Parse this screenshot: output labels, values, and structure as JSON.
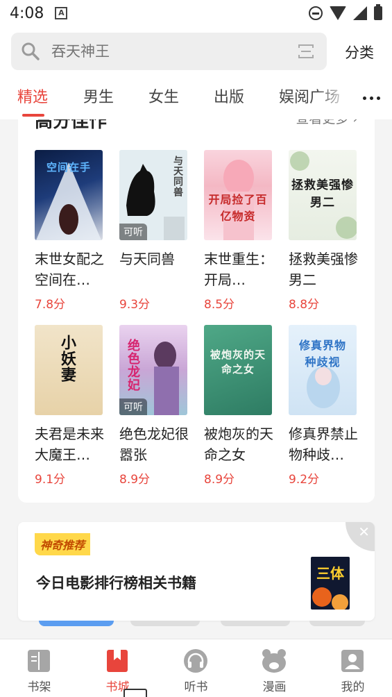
{
  "status_bar": {
    "time": "4:08",
    "notif_letter": "A"
  },
  "search": {
    "placeholder": "吞天神王"
  },
  "header": {
    "category_label": "分类"
  },
  "tabs": [
    {
      "label": "精选",
      "active": true
    },
    {
      "label": "男生",
      "active": false
    },
    {
      "label": "女生",
      "active": false
    },
    {
      "label": "出版",
      "active": false
    },
    {
      "label": "娱阅广场",
      "active": false
    }
  ],
  "section": {
    "title": "高分佳作",
    "more_label": "查看更多 ›"
  },
  "books": [
    {
      "title": "末世女配之空间在…",
      "score": "7.8分",
      "cover_text": "空间在手",
      "listen": ""
    },
    {
      "title": "与天同兽",
      "score": "9.3分",
      "cover_text": "与天同兽",
      "listen": "可听"
    },
    {
      "title": "末世重生：开局…",
      "score": "8.5分",
      "cover_text": "开局捡了百亿物资",
      "listen": ""
    },
    {
      "title": "拯救美强惨男二",
      "score": "8.8分",
      "cover_text": "拯救美强惨男二",
      "listen": ""
    },
    {
      "title": "夫君是未来大魔王…",
      "score": "9.1分",
      "cover_text": "小妖妻",
      "listen": ""
    },
    {
      "title": "绝色龙妃很嚣张",
      "score": "8.9分",
      "cover_text": "绝色龙妃",
      "listen": "可听"
    },
    {
      "title": "被炮灰的天命之女",
      "score": "8.9分",
      "cover_text": "被炮灰的天命之女",
      "listen": ""
    },
    {
      "title": "修真界禁止物种歧…",
      "score": "9.2分",
      "cover_text": "修真界物种歧视",
      "listen": ""
    }
  ],
  "recommend": {
    "badge": "神奇推荐",
    "title": "今日电影排行榜相关书籍",
    "cover_text": "三体",
    "close": "✕"
  },
  "bottom_nav": [
    {
      "label": "书架",
      "icon": "bookshelf-icon",
      "active": false
    },
    {
      "label": "书城",
      "icon": "bookstore-icon",
      "active": true
    },
    {
      "label": "听书",
      "icon": "headphones-icon",
      "active": false
    },
    {
      "label": "漫画",
      "icon": "comic-bear-icon",
      "active": false
    },
    {
      "label": "我的",
      "icon": "profile-icon",
      "active": false
    }
  ],
  "colors": {
    "accent": "#e8453c",
    "badge_bg": "#ffd84a"
  }
}
